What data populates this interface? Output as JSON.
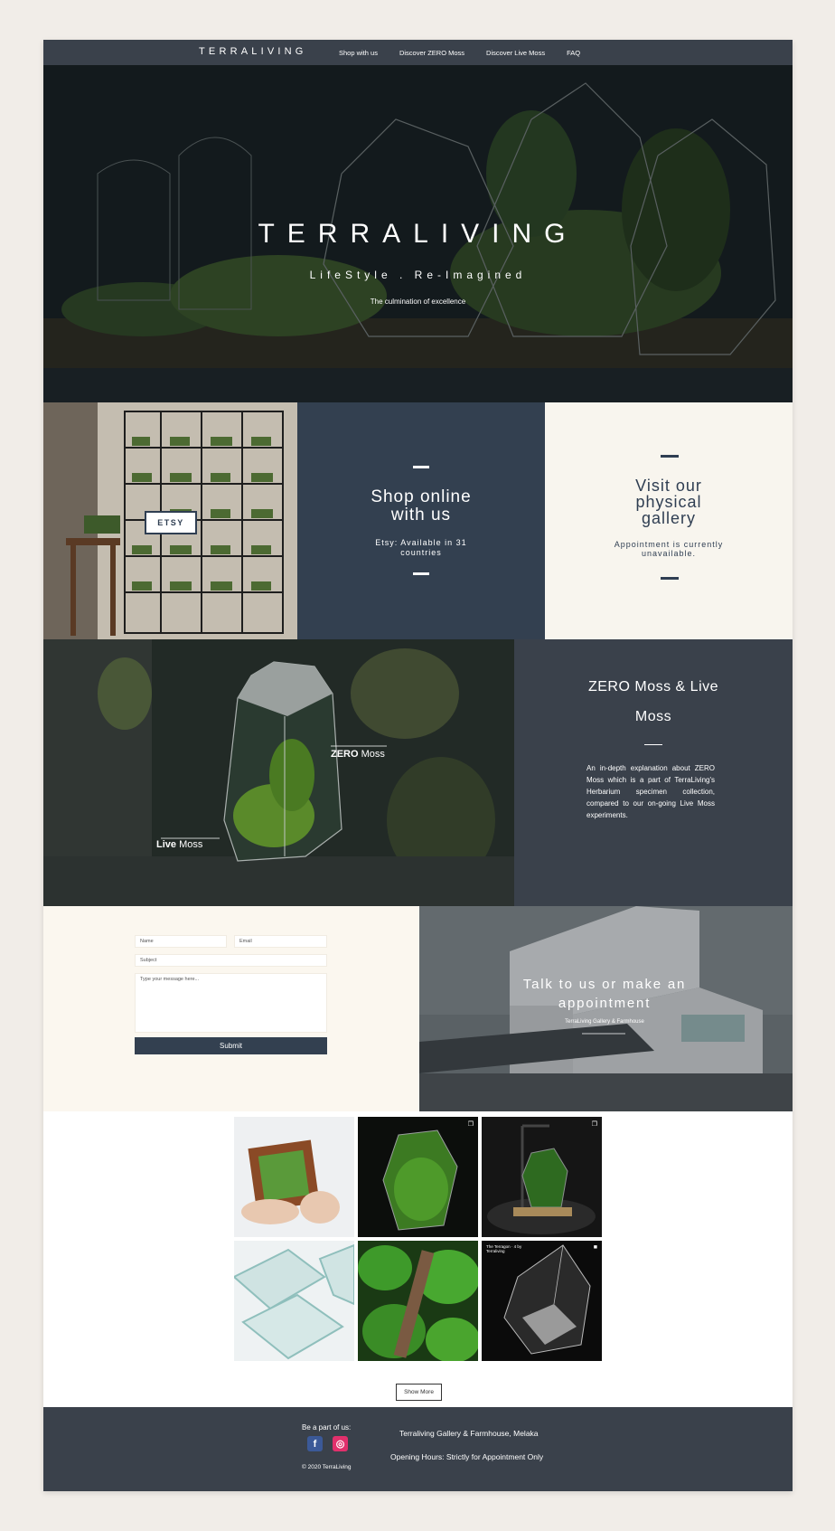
{
  "nav": {
    "brand": "TERRALIVING",
    "links": [
      "Shop with us",
      "Discover ZERO Moss",
      "Discover Live Moss",
      "FAQ"
    ]
  },
  "hero": {
    "title": "TERRALIVING",
    "tagline": "LifeStyle . Re-Imagined",
    "subtitle": "The culmination of excellence"
  },
  "shop": {
    "etsy_label": "ETSY",
    "heading_line1": "Shop online",
    "heading_line2": "with us",
    "text_line1": "Etsy: Available in 31",
    "text_line2": "countries"
  },
  "visit": {
    "heading_line1": "Visit our",
    "heading_line2": "physical",
    "heading_line3": "gallery",
    "text_line1": "Appointment is currently",
    "text_line2": "unavailable."
  },
  "moss": {
    "label_zero_bold": "ZERO",
    "label_zero_rest": " Moss",
    "label_live_bold": "Live",
    "label_live_rest": " Moss",
    "heading_line1": "ZERO Moss & Live",
    "heading_line2": "Moss",
    "description": "An in-depth explanation about ZERO Moss which is a part of TerraLiving's Herbarium specimen collection, compared to our on-going Live Moss experiments."
  },
  "contact": {
    "name_placeholder": "Name",
    "email_placeholder": "Email",
    "subject_placeholder": "Subject",
    "message_placeholder": "Type your message here...",
    "submit_label": "Submit"
  },
  "farm": {
    "heading_line1": "Talk to us or make an",
    "heading_line2": "appointment",
    "caption": "TerraLiving Gallery & Farmhouse"
  },
  "gallery": {
    "tile_caption": "The Terragon · 4 by Terraliving",
    "show_more_label": "Show More"
  },
  "footer": {
    "be_part": "Be a part of us:",
    "copyright": "© 2020 TerraLiving",
    "address": "Terraliving Gallery & Farmhouse, Melaka",
    "hours": "Opening Hours: Strictly for Appointment Only",
    "facebook_letter": "f",
    "instagram_glyph": "◎"
  },
  "colors": {
    "nav_bg": "#3a414b",
    "navy": "#334050",
    "cream": "#f8f5ee",
    "page_bg": "#f1ede8"
  }
}
